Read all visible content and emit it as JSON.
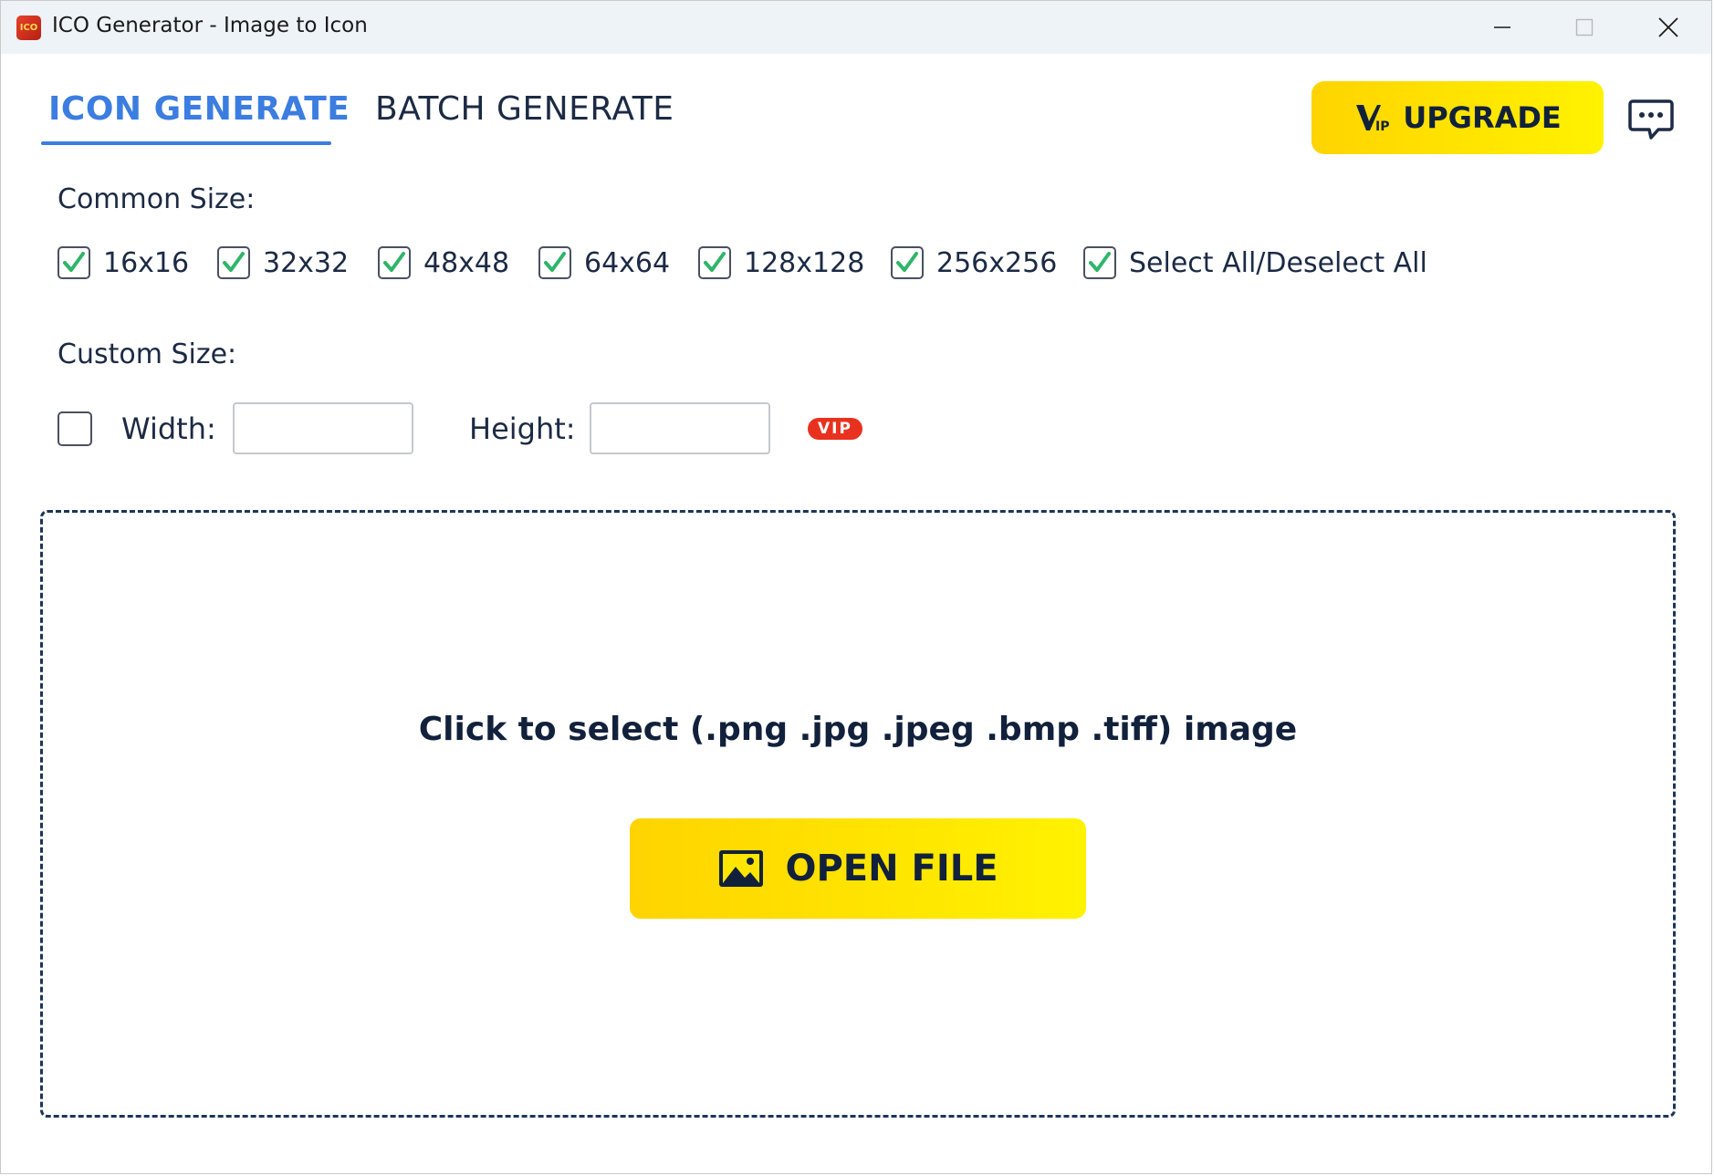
{
  "window": {
    "title": "ICO Generator - Image to Icon",
    "app_icon_text": "ICO"
  },
  "tabs": [
    {
      "label": "ICON GENERATE",
      "active": true
    },
    {
      "label": "BATCH GENERATE",
      "active": false
    }
  ],
  "header": {
    "upgrade_label": "UPGRADE",
    "upgrade_icon": "vip-icon",
    "feedback_icon": "chat-bubble-icon"
  },
  "common_size": {
    "label": "Common Size:",
    "options": [
      {
        "label": "16x16",
        "checked": true
      },
      {
        "label": "32x32",
        "checked": true
      },
      {
        "label": "48x48",
        "checked": true
      },
      {
        "label": "64x64",
        "checked": true
      },
      {
        "label": "128x128",
        "checked": true
      },
      {
        "label": "256x256",
        "checked": true
      },
      {
        "label": "Select All/Deselect All",
        "checked": true
      }
    ]
  },
  "custom_size": {
    "label": "Custom Size:",
    "enabled": false,
    "width_label": "Width:",
    "width_value": "",
    "height_label": "Height:",
    "height_value": "",
    "vip_badge": "VIP"
  },
  "dropzone": {
    "hint": "Click to select (.png .jpg .jpeg .bmp .tiff) image",
    "open_button_label": "OPEN FILE",
    "open_button_icon": "image-icon"
  },
  "colors": {
    "accent_blue": "#3b7de0",
    "button_yellow": "#ffd400",
    "check_green": "#2fb56a",
    "vip_red": "#e8321f",
    "dark_navy": "#12213b"
  }
}
